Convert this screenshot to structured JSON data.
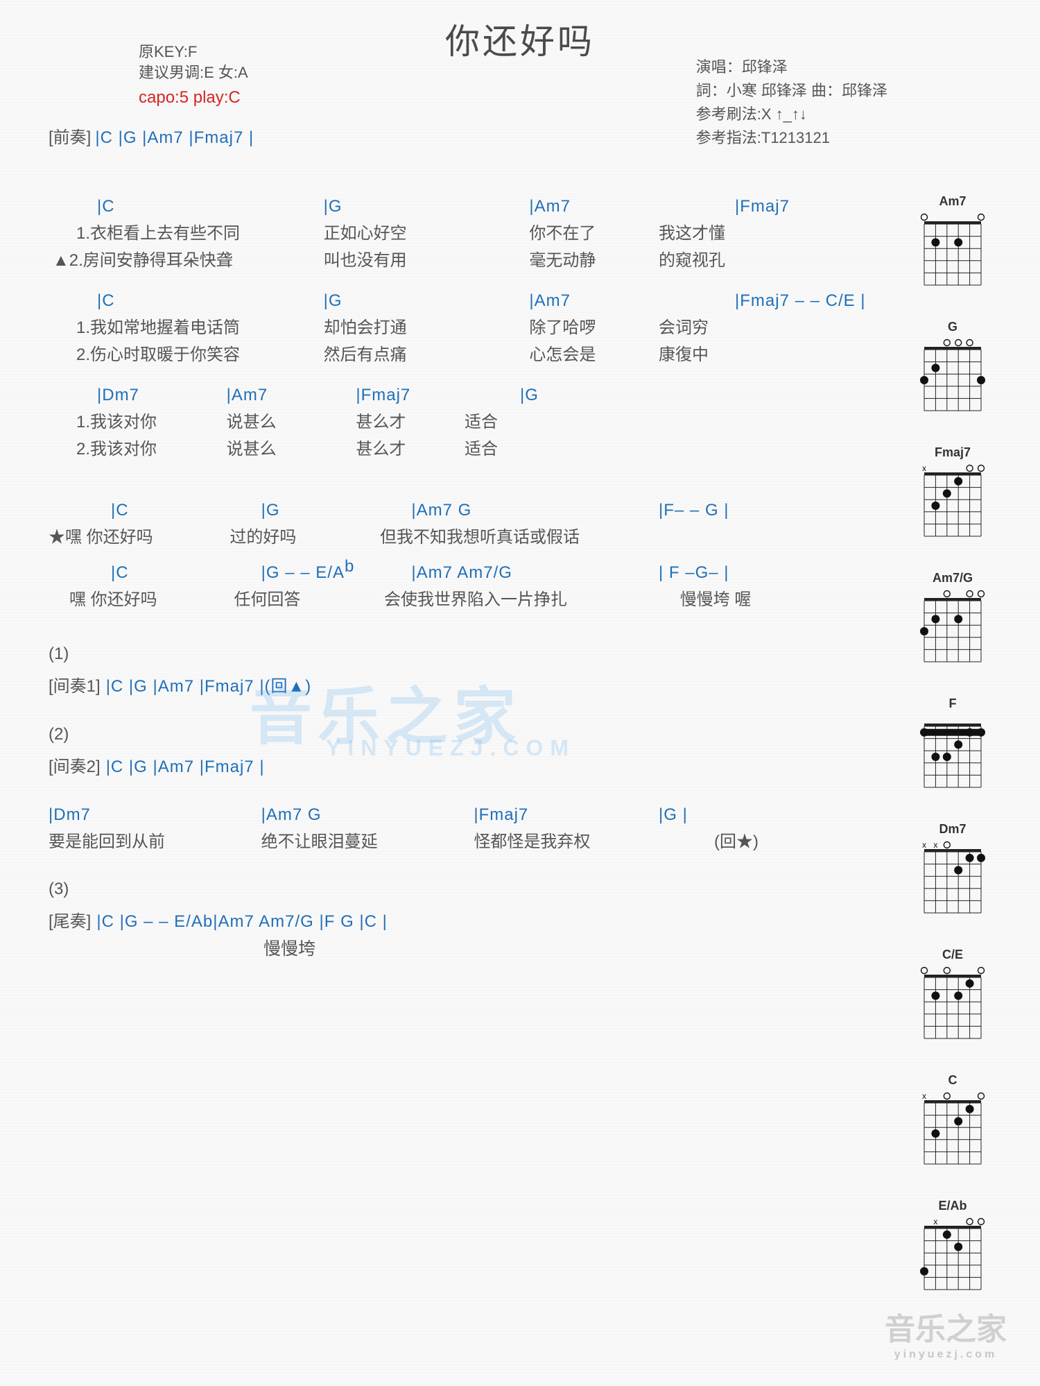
{
  "title": "你还好吗",
  "meta": {
    "original_key": "原KEY:F",
    "suggest": "建议男调:E 女:A",
    "capo": "capo:5 play:C",
    "singer_label": "演唱：邱锋泽",
    "lyricist_label": "詞：小寒 邱锋泽    曲：邱锋泽",
    "strum_label": "参考刷法:X ↑_↑↓",
    "finger_label": "参考指法:T1213121"
  },
  "sections": {
    "intro_label": "[前奏]",
    "intro_chords": "|C     |G     |Am7     |Fmaj7          |",
    "verseA_chords": [
      "|C",
      "|G",
      "|Am7",
      "|Fmaj7"
    ],
    "verseA_l1": [
      "1.衣柜看上去有些不同",
      "正如心好空",
      "你不在了",
      "我这才懂"
    ],
    "verseA_l2": [
      "▲2.房间安静得耳朵快聋",
      "叫也没有用",
      "毫无动静",
      "的窥视孔"
    ],
    "verseB_chords": [
      "|C",
      "|G",
      "|Am7",
      "|Fmaj7 – – C/E  |"
    ],
    "verseB_l1": [
      "1.我如常地握着电话筒",
      "却怕会打通",
      "除了哈啰",
      "会词穷"
    ],
    "verseB_l2": [
      "2.伤心时取暖于你笑容",
      "然后有点痛",
      "心怎会是",
      "康復中"
    ],
    "pre_chords": [
      "|Dm7",
      "|Am7",
      "|Fmaj7",
      "|G"
    ],
    "pre_l1": [
      "1.我该对你",
      "说甚么",
      "甚么才",
      "适合"
    ],
    "pre_l2": [
      "2.我该对你",
      "说甚么",
      "甚么才",
      "适合"
    ],
    "chorus1_chords": [
      "|C",
      "|G",
      "|Am7     G",
      "|F–   – G         |"
    ],
    "chorus1_lyrics_prefix": "★嘿 ",
    "chorus1_lyrics": [
      "你还好吗",
      "过的好吗",
      "但我不知我想听真话或假话",
      ""
    ],
    "chorus2_chords": [
      "|C",
      "|G – – E/A",
      "|Am7   Am7/G",
      "| F  –G–            |"
    ],
    "chorus2_lyrics_prefix": "嘿 ",
    "chorus2_lyrics": [
      "你还好吗",
      "任何回答",
      "会使我世界陷入一片挣扎",
      "慢慢垮  喔"
    ],
    "n1": "(1)",
    "inter1_label": "[间奏1]",
    "inter1_chords": "|C    |G    |Am7    |Fmaj7    |(回▲)",
    "n2": "(2)",
    "inter2_label": "[间奏2]",
    "inter2_chords": "|C    |G    |Am7    |Fmaj7    |",
    "bridge_chords": [
      "|Dm7",
      "|Am7    G",
      "|Fmaj7",
      "|G           |"
    ],
    "bridge_lyrics": [
      "要是能回到从前",
      "绝不让眼泪蔓延",
      "怪都怪是我弃权",
      "(回★)"
    ],
    "n3": "(3)",
    "outro_label": "[尾奏]",
    "outro_chords": "|C  |G  – –  E/A",
    "outro_chords2": "  |Am7     Am7/G  |F     G    |C           |",
    "outro_lyric": "慢慢垮"
  },
  "b_sup": "b",
  "diagrams": [
    {
      "name": "Am7",
      "dots": [
        [
          1,
          2
        ],
        [
          3,
          2
        ]
      ],
      "opens": [
        0,
        5
      ],
      "mutes": []
    },
    {
      "name": "G",
      "dots": [
        [
          0,
          3
        ],
        [
          1,
          2
        ],
        [
          5,
          3
        ]
      ],
      "opens": [
        2,
        3,
        4
      ],
      "mutes": []
    },
    {
      "name": "Fmaj7",
      "dots": [
        [
          1,
          3
        ],
        [
          2,
          2
        ],
        [
          3,
          1
        ]
      ],
      "opens": [
        4,
        5
      ],
      "mutes": [
        0
      ]
    },
    {
      "name": "Am7/G",
      "dots": [
        [
          0,
          3
        ],
        [
          1,
          2
        ],
        [
          3,
          2
        ]
      ],
      "opens": [
        2,
        4,
        5
      ],
      "mutes": []
    },
    {
      "name": "F",
      "dots": [
        [
          0,
          1
        ],
        [
          1,
          3
        ],
        [
          2,
          3
        ],
        [
          3,
          2
        ],
        [
          4,
          1
        ],
        [
          5,
          1
        ]
      ],
      "opens": [],
      "mutes": [],
      "barre": 1
    },
    {
      "name": "Dm7",
      "dots": [
        [
          3,
          2
        ],
        [
          4,
          1
        ],
        [
          5,
          1
        ]
      ],
      "opens": [
        2
      ],
      "mutes": [
        0,
        1
      ]
    },
    {
      "name": "C/E",
      "dots": [
        [
          1,
          2
        ],
        [
          3,
          2
        ],
        [
          4,
          1
        ]
      ],
      "opens": [
        0,
        2,
        5
      ],
      "mutes": []
    },
    {
      "name": "C",
      "dots": [
        [
          1,
          3
        ],
        [
          3,
          2
        ],
        [
          4,
          1
        ]
      ],
      "opens": [
        2,
        5
      ],
      "mutes": [
        0
      ]
    },
    {
      "name": "E/Ab",
      "dots": [
        [
          0,
          4
        ],
        [
          2,
          1
        ],
        [
          3,
          2
        ]
      ],
      "opens": [
        4,
        5
      ],
      "mutes": [
        1
      ]
    }
  ],
  "watermark_main": "音乐之家",
  "watermark_url": "YINYUEZJ.COM",
  "watermark_footer": "音乐之家",
  "watermark_footer_sub": "yinyuezj.com"
}
